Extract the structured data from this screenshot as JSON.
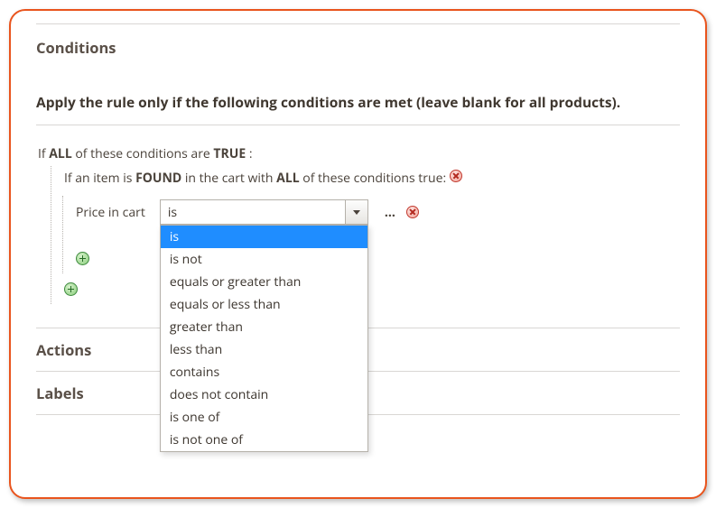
{
  "sections": {
    "conditions": "Conditions",
    "actions": "Actions",
    "labels": "Labels"
  },
  "rule_header": "Apply the rule only if the following conditions are met (leave blank for all products).",
  "cond": {
    "root_prefix": "If ",
    "root_all": "ALL",
    "root_mid": " of these conditions are ",
    "root_true": "TRUE",
    "root_suffix": " :",
    "item_prefix": "If an item is ",
    "item_found": "FOUND",
    "item_mid": " in the cart with ",
    "item_all": "ALL",
    "item_suffix": " of these conditions true: ",
    "attr_label": "Price in cart",
    "ellipsis": "..."
  },
  "operator": {
    "selected": "is",
    "options": [
      "is",
      "is not",
      "equals or greater than",
      "equals or less than",
      "greater than",
      "less than",
      "contains",
      "does not contain",
      "is one of",
      "is not one of"
    ]
  }
}
